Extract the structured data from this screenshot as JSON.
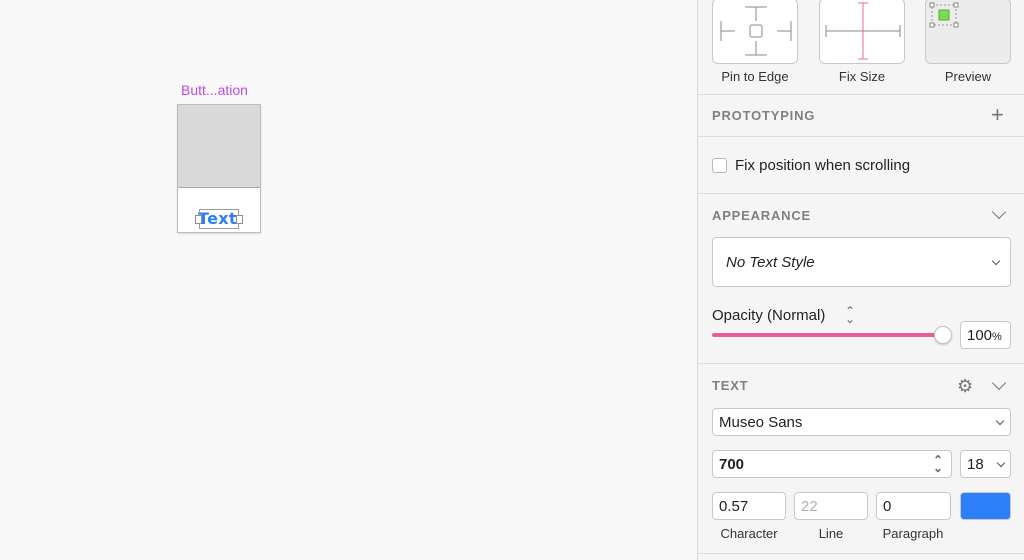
{
  "canvas": {
    "symbol_label": "Butt...ation",
    "symbol_text": "Text"
  },
  "resizing": {
    "pin_to_edge": "Pin to Edge",
    "fix_size": "Fix Size",
    "preview": "Preview"
  },
  "prototyping": {
    "title": "PROTOTYPING",
    "fix_position_label": "Fix position when scrolling"
  },
  "appearance": {
    "title": "APPEARANCE",
    "text_style": "No Text Style",
    "opacity_label": "Opacity (Normal)",
    "opacity_value": "100",
    "opacity_unit": "%",
    "opacity_level": 1.0,
    "slider_color": "#e75d9d"
  },
  "text": {
    "title": "TEXT",
    "font": "Museo Sans",
    "weight": "700",
    "size": "18",
    "character_value": "0.57",
    "line_placeholder": "22",
    "paragraph_value": "0",
    "character_label": "Character",
    "line_label": "Line",
    "paragraph_label": "Paragraph",
    "color": "#2d7ff9"
  },
  "icons": {
    "add": "plus-icon",
    "collapse": "chevron-down-icon",
    "settings": "gear-icon"
  }
}
